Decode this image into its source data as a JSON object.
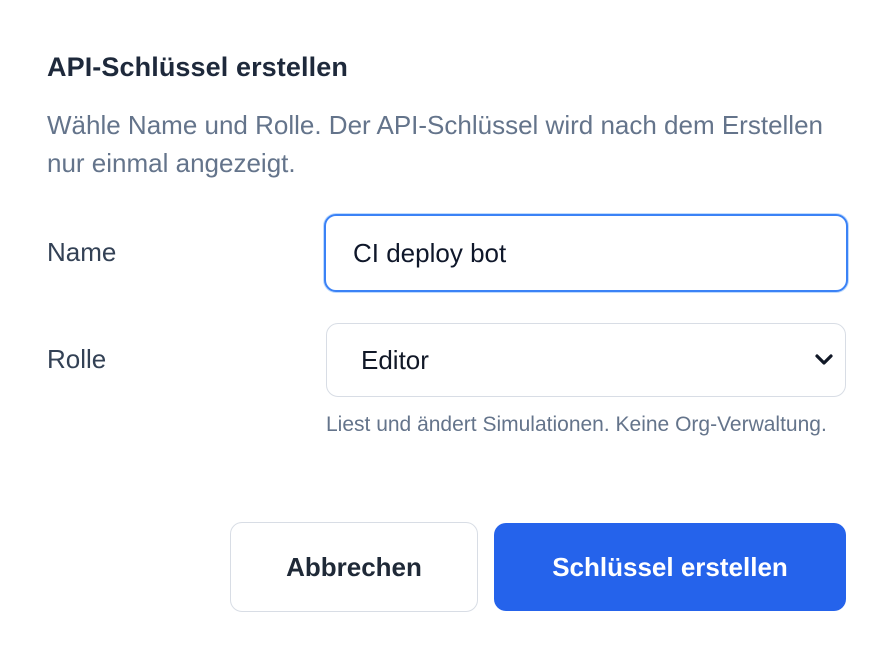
{
  "dialog": {
    "title": "API-Schlüssel erstellen",
    "subtitle": "Wähle Name und Rolle. Der API-Schlüssel wird nach dem Erstellen nur einmal angezeigt."
  },
  "form": {
    "name_label": "Name",
    "name_value": "CI deploy bot",
    "role_label": "Rolle",
    "role_value": "Editor",
    "role_help": "Liest und ändert Simulationen. Keine Org-Verwaltung."
  },
  "actions": {
    "cancel_label": "Abbrechen",
    "create_label": "Schlüssel erstellen"
  },
  "colors": {
    "primary": "#2563eb",
    "focus_border": "#3b82f6",
    "muted_text": "#64748b"
  },
  "icons": {
    "select_arrow": "chevron-down-icon"
  }
}
